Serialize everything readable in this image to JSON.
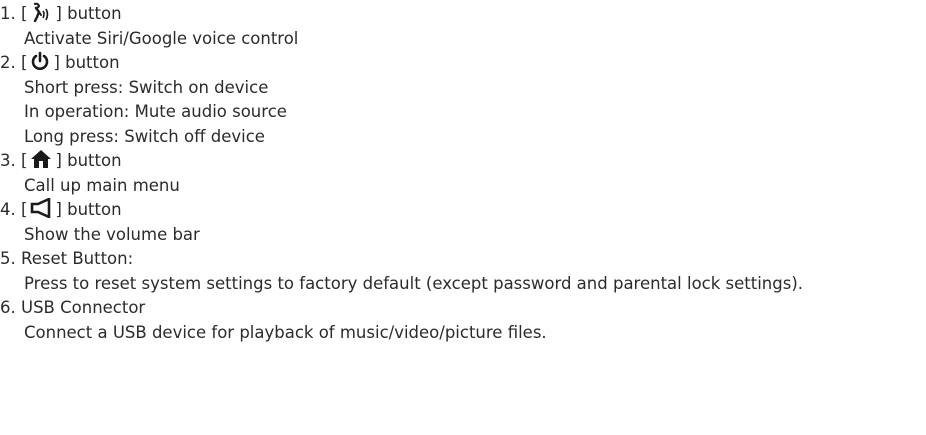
{
  "items": [
    {
      "number": "1.",
      "bracket_open": "[",
      "icon": "voice-control-icon",
      "bracket_close": "] button",
      "lines": [
        "Activate Siri/Google voice control"
      ]
    },
    {
      "number": "2.",
      "bracket_open": "[",
      "icon": "power-icon",
      "bracket_close": "] button",
      "lines": [
        "Short press: Switch on device",
        "In operation: Mute audio source",
        "Long press: Switch off device"
      ]
    },
    {
      "number": "3.",
      "bracket_open": "[",
      "icon": "home-icon",
      "bracket_close": "] button",
      "lines": [
        "Call up main menu"
      ]
    },
    {
      "number": "4.",
      "bracket_open": "[",
      "icon": "speaker-icon",
      "bracket_close": "] button",
      "lines": [
        "Show the volume bar"
      ]
    },
    {
      "number": "5.",
      "title": "Reset Button:",
      "lines": [
        "Press to reset system settings to factory default (except password and parental lock settings)."
      ]
    },
    {
      "number": "6.",
      "title": "USB Connector",
      "lines": [
        "Connect a USB device for playback of music/video/picture files."
      ]
    }
  ],
  "colors": {
    "text": "#2b2b2b",
    "icon": "#1a1a1a"
  }
}
